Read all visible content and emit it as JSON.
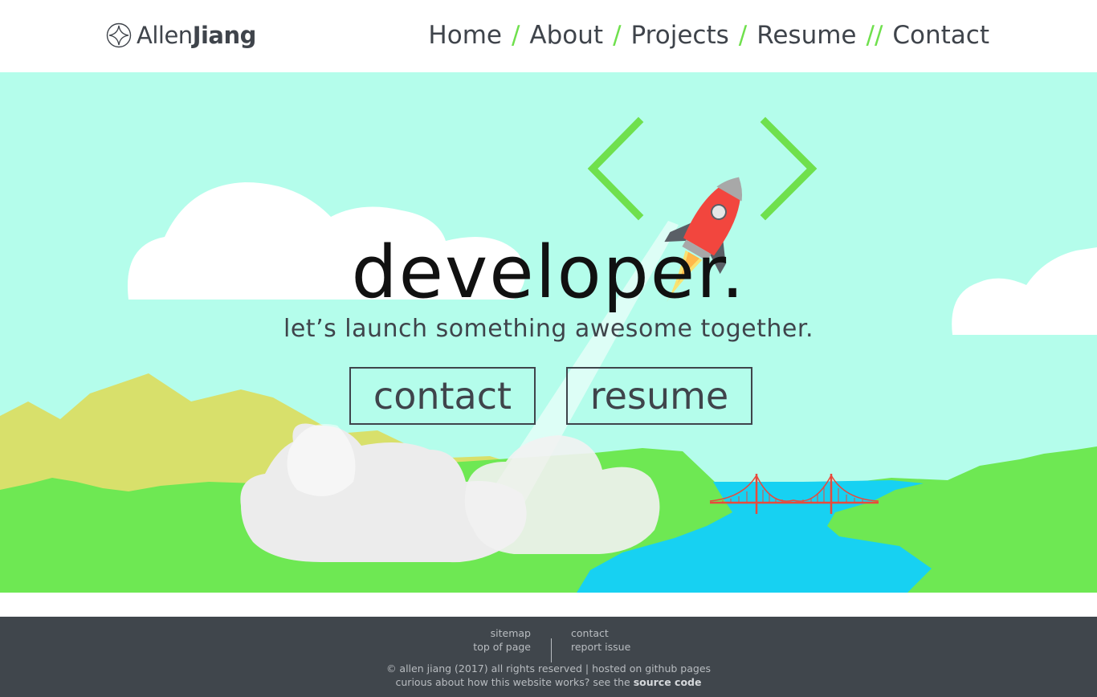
{
  "brand": {
    "first": "Allen",
    "last": "Jiang"
  },
  "nav": {
    "items": [
      "Home",
      "About",
      "Projects",
      "Resume",
      "Contact"
    ],
    "separators": [
      "/",
      "/",
      "/",
      "//"
    ]
  },
  "hero": {
    "headline": "developer.",
    "tagline": "let’s launch something awesome together.",
    "contact_button": "contact",
    "resume_button": "resume"
  },
  "footer": {
    "left_links": [
      "sitemap",
      "top of page"
    ],
    "right_links": [
      "contact",
      "report issue"
    ],
    "copyright": "© allen jiang (2017) all rights reserved |  hosted on github pages",
    "source_prefix": "curious about how this website works? see the ",
    "source_link": "source code"
  },
  "colors": {
    "sky": "#b4fdeb",
    "grass": "#6ee853",
    "hills": "#d8e06b",
    "water": "#17d1f2",
    "rocket": "#f2463e",
    "accent": "#6fe04d",
    "footer": "#40464c"
  },
  "icons": [
    "logo-icon",
    "rocket-icon",
    "bridge-icon"
  ]
}
